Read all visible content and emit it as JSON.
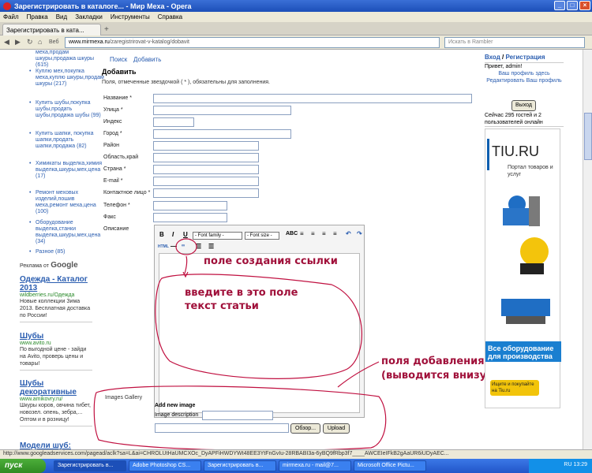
{
  "window": {
    "title": "Зарегистрировать в каталоге... - Мир Меха - Opera"
  },
  "menu": [
    "Файл",
    "Правка",
    "Вид",
    "Закладки",
    "Инструменты",
    "Справка"
  ],
  "tab": {
    "label": "Зарегистрировать в ката..."
  },
  "nav": {
    "web_label": "Веб",
    "address_host": "www.mirmexa.ru",
    "address_path": "/zaregistrirovat-v-katalog/dobavit",
    "search_placeholder": "Искать в Rambler"
  },
  "sidebar": {
    "categories": [
      "меха,продам шкуры,продажа шкуры (615)",
      "Куплю мех,покупка меха,куплю шкуры,продам шкуры (217)",
      "Купить шубы,покупка шубы,продать шубы,продажа шубы (99)",
      "Купить шапки, покупка шапки,продать шапки,продажа (82)",
      "Химикаты выделка,химия выделка,шкуры,мех,цена (17)",
      "Ремонт меховых изделий,пошив меха,ремонт меха,цена (100)",
      "Оборудование выделка,станки выделка,шкуры,мех,цена (34)",
      "Разное (85)"
    ],
    "ads_header": "Реклама от",
    "ads_brand": "Google",
    "ads": [
      {
        "title": "Одежда - Каталог 2013",
        "url": "wildberries.ru/Одежда",
        "text": "Новые коллекции Зима 2013. Бесплатная доставка по России!"
      },
      {
        "title": "Шубы",
        "url": "www.avito.ru",
        "text": "По выгодной цене - зайди на Avito, проверь цены и товары!"
      },
      {
        "title": "Шубы декоративные",
        "url": "www.amikovry.ru/",
        "text": "Шкуры коров, овчина тибет, новозел. опень, зебра,... Оптом и в розницу!"
      },
      {
        "title": "Модели шуб:",
        "url": "",
        "text": ""
      }
    ]
  },
  "main": {
    "search_link": "Поиск",
    "add_link": "Добавить",
    "heading": "Добавить",
    "note": "Поля, отмеченные звездочкой ( * ), обязательны для заполнения.",
    "fields": [
      "Название *",
      "Улица *",
      "Индекс",
      "Город *",
      "Район",
      "Область,край",
      "Страна *",
      "E-mail *",
      "Контактное лицо *",
      "Телефон *",
      "Факс",
      "Описание"
    ],
    "editor": {
      "font_family": "- Font family -",
      "font_size": "- Font size -",
      "html_label": "HTML"
    },
    "gallery": {
      "title": "Images Gallery",
      "add_new": "Add new image",
      "desc_label": "Image description",
      "browse": "Обзор...",
      "upload": "Upload"
    }
  },
  "annotations": {
    "link_field": "поле создания ссылки",
    "text_field": "введите в это поле текст статьи",
    "photo_fields": "поля добавления фото (выводится внизу статьи)"
  },
  "right": {
    "login": "Вход",
    "register": "Регистрация",
    "greeting": "Привет, admin!",
    "profile_link": "Ваш профиль здесь",
    "edit_profile": "Редактировать Ваш профиль",
    "logout": "Выход",
    "online": "Сейчас 295 гостей и 2 пользователей онлайн",
    "tiu": {
      "brand": "TIU.RU",
      "tagline": "Портал товаров и услуг",
      "banner": "Все оборудование для производства",
      "cta": "Ищите и покупайте на Tiu.ru"
    }
  },
  "statusbar": {
    "url": "http://www.googleadservices.com/pagead/aclk?sa=L&ai=CHROLUtHaUMCXOc_DyAPFiHWDYWt48EE3YtFnGvIu-28RBABI3a-6yBQ9fRbp3f7____AWCEIeIFkB2gAaUR6iUDyAEC..."
  },
  "taskbar": {
    "start": "пуск",
    "items": [
      "Зарегистрировать в...",
      "Adobe Photoshop CS...",
      "Зарегистрировать в...",
      "mirmexa.ru - mail@7...",
      "Microsoft Office Pictu..."
    ],
    "lang": "RU",
    "clock": "13:29"
  }
}
